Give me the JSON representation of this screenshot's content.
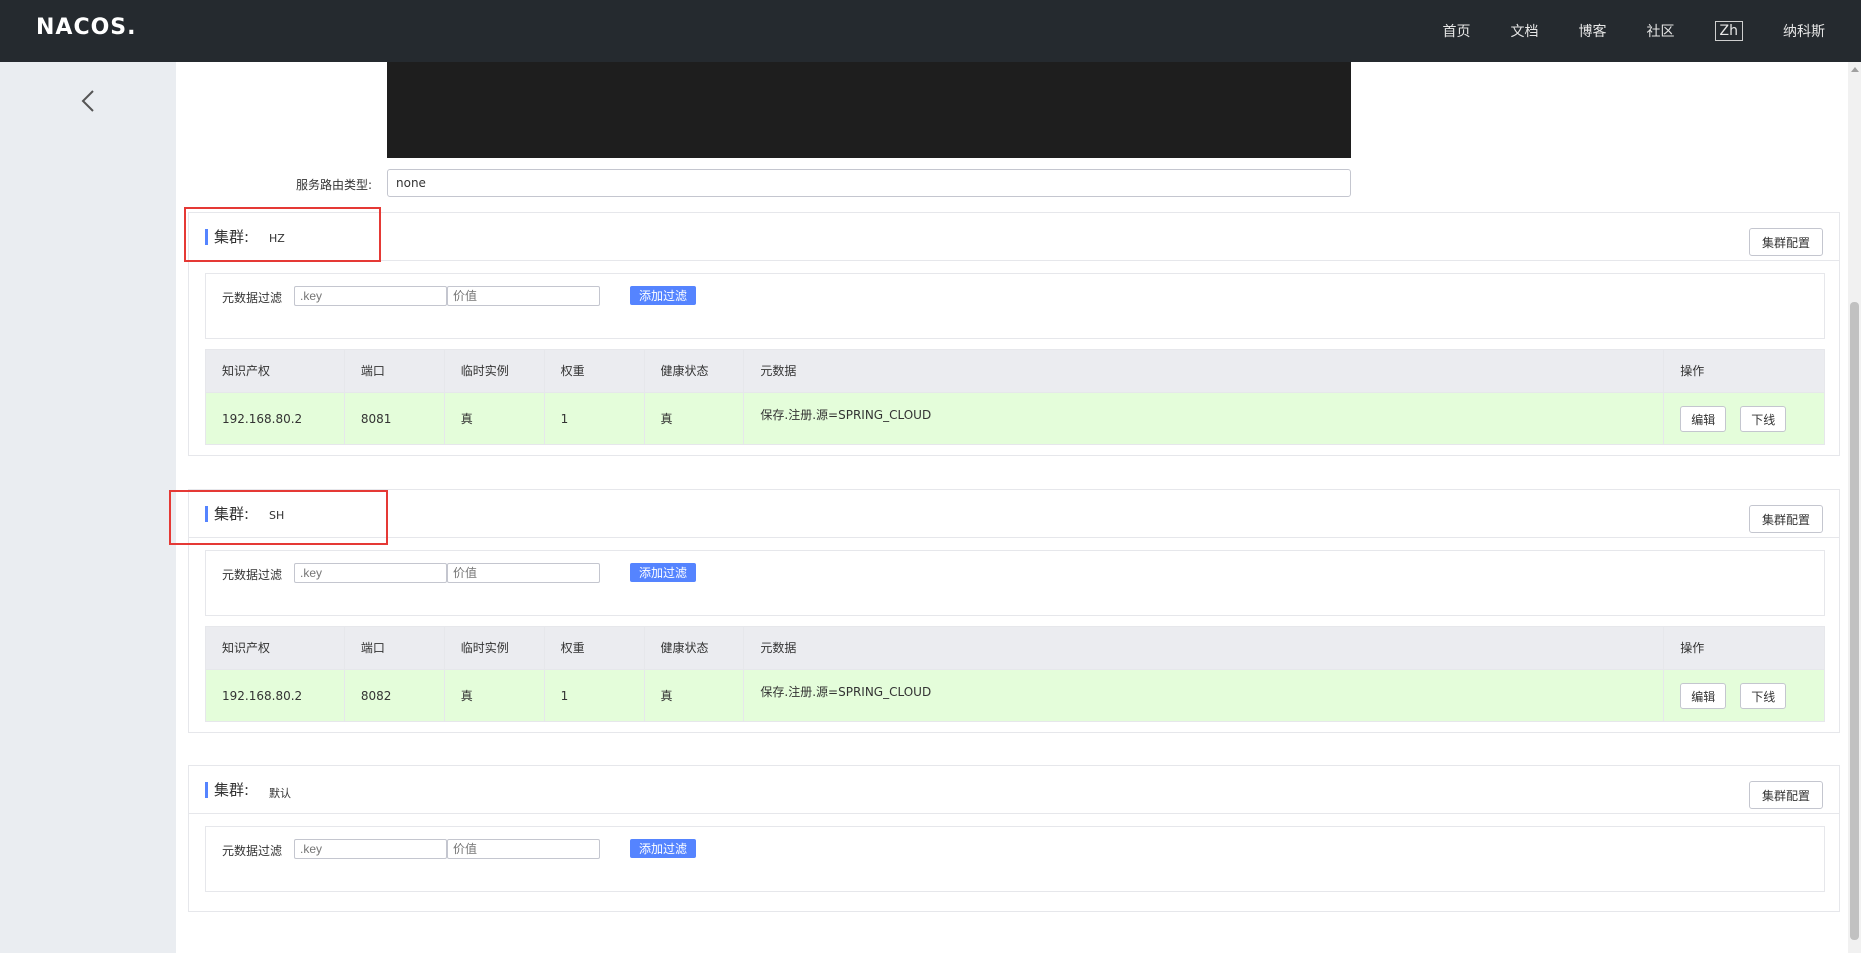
{
  "header": {
    "logo": "NACOS.",
    "nav": [
      "首页",
      "文档",
      "博客",
      "社区"
    ],
    "lang": "Zh",
    "brand": "纳科斯"
  },
  "route": {
    "label": "服务路由类型:",
    "value": "none"
  },
  "labels": {
    "cluster_prefix": "集群:",
    "cluster_config": "集群配置",
    "filter_label": "元数据过滤",
    "key_placeholder": ".key",
    "value_placeholder": "价值",
    "add_filter": "添加过滤",
    "edit": "编辑",
    "offline": "下线"
  },
  "table_headers": [
    "知识产权",
    "端口",
    "临时实例",
    "权重",
    "健康状态",
    "元数据",
    "操作"
  ],
  "clusters": [
    {
      "name": "HZ",
      "rows": [
        {
          "ip": "192.168.80.2",
          "port": "8081",
          "ephemeral": "真",
          "weight": "1",
          "healthy": "真",
          "metadata": "保存.注册.源=SPRING_CLOUD"
        }
      ]
    },
    {
      "name": "SH",
      "rows": [
        {
          "ip": "192.168.80.2",
          "port": "8082",
          "ephemeral": "真",
          "weight": "1",
          "healthy": "真",
          "metadata": "保存.注册.源=SPRING_CLOUD"
        }
      ]
    },
    {
      "name": "默认",
      "rows": []
    }
  ],
  "colors": {
    "topbar": "#252a2f",
    "primary": "#5584ff",
    "row_healthy": "#e4fdda",
    "highlight": "#e53935"
  }
}
